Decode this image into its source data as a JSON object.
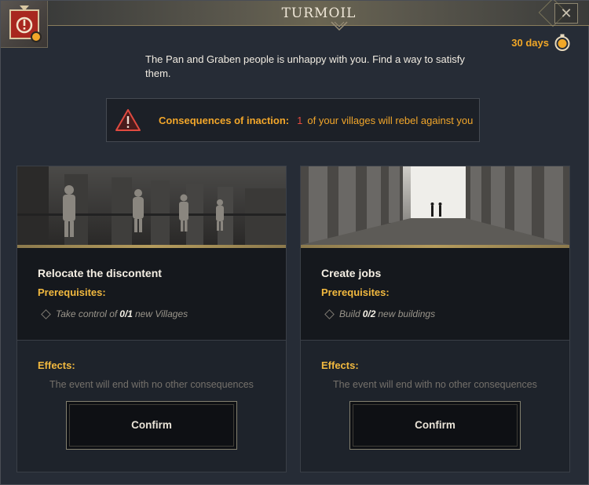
{
  "dialog": {
    "title": "TURMOIL",
    "close_icon": "close-icon",
    "badge_icon": "alert-badge-icon"
  },
  "timer": {
    "label": "30 days",
    "icon": "stopwatch-icon",
    "accent": "#f1a727"
  },
  "description": "The Pan and Graben people is unhappy with you. Find a way to satisfy them.",
  "warning": {
    "icon": "warning-triangle-icon",
    "label": "Consequences of inaction:",
    "count": "1",
    "text": "of your villages will rebel against you"
  },
  "options": [
    {
      "title": "Relocate the discontent",
      "prereq_label": "Prerequisites:",
      "prereq_prefix": "Take control of",
      "prereq_progress": "0/1",
      "prereq_suffix": "new Villages",
      "effects_label": "Effects:",
      "effects_text": "The event will end with no other consequences",
      "confirm_label": "Confirm"
    },
    {
      "title": "Create jobs",
      "prereq_label": "Prerequisites:",
      "prereq_prefix": "Build",
      "prereq_progress": "0/2",
      "prereq_suffix": "new buildings",
      "effects_label": "Effects:",
      "effects_text": "The event will end with no other consequences",
      "confirm_label": "Confirm"
    }
  ]
}
